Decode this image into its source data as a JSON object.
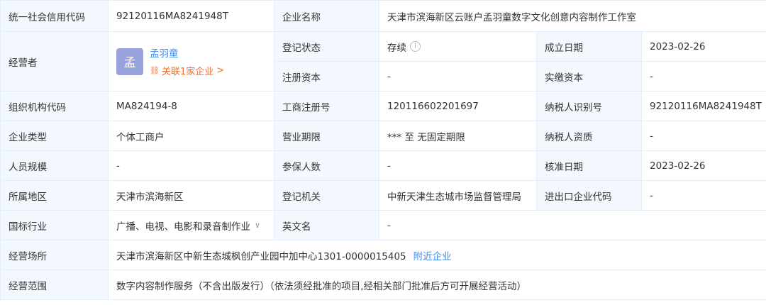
{
  "credit_code": {
    "label": "统一社会信用代码",
    "value": "92120116MA8241948T"
  },
  "company_name": {
    "label": "企业名称",
    "value": "天津市滨海新区云账户孟羽童数字文化创意内容制作工作室"
  },
  "operator": {
    "label": "经营者",
    "avatar_char": "孟",
    "name": "孟羽童",
    "related": "关联1家企业",
    "chevron": ">"
  },
  "reg_status": {
    "label": "登记状态",
    "value": "存续",
    "info_icon": "i"
  },
  "founded": {
    "label": "成立日期",
    "value": "2023-02-26"
  },
  "reg_capital": {
    "label": "注册资本",
    "value": "-"
  },
  "paid_capital": {
    "label": "实缴资本",
    "value": "-"
  },
  "org_code": {
    "label": "组织机构代码",
    "value": "MA824194-8"
  },
  "biz_reg_no": {
    "label": "工商注册号",
    "value": "120116602201697"
  },
  "taxpayer_id": {
    "label": "纳税人识别号",
    "value": "92120116MA8241948T"
  },
  "company_type": {
    "label": "企业类型",
    "value": "个体工商户"
  },
  "biz_term": {
    "label": "营业期限",
    "value": "*** 至 无固定期限"
  },
  "taxpayer_qual": {
    "label": "纳税人资质",
    "value": "-"
  },
  "staff_size": {
    "label": "人员规模",
    "value": "-"
  },
  "insured": {
    "label": "参保人数",
    "value": "-"
  },
  "approval_date": {
    "label": "核准日期",
    "value": "2023-02-26"
  },
  "region": {
    "label": "所属地区",
    "value": "天津市滨海新区"
  },
  "reg_authority": {
    "label": "登记机关",
    "value": "中新天津生态城市场监督管理局"
  },
  "import_export": {
    "label": "进出口企业代码",
    "value": "-"
  },
  "industry": {
    "label": "国标行业",
    "value": "广播、电视、电影和录音制作业",
    "chevron": "∨"
  },
  "english_name": {
    "label": "英文名",
    "value": "-"
  },
  "address": {
    "label": "经营场所",
    "value": "天津市滨海新区中新生态城枫创产业园中加中心1301-0000015405",
    "nearby": "附近企业"
  },
  "scope": {
    "label": "经营范围",
    "value": "数字内容制作服务（不含出版发行）（依法须经批准的项目,经相关部门批准后方可开展经营活动）"
  }
}
